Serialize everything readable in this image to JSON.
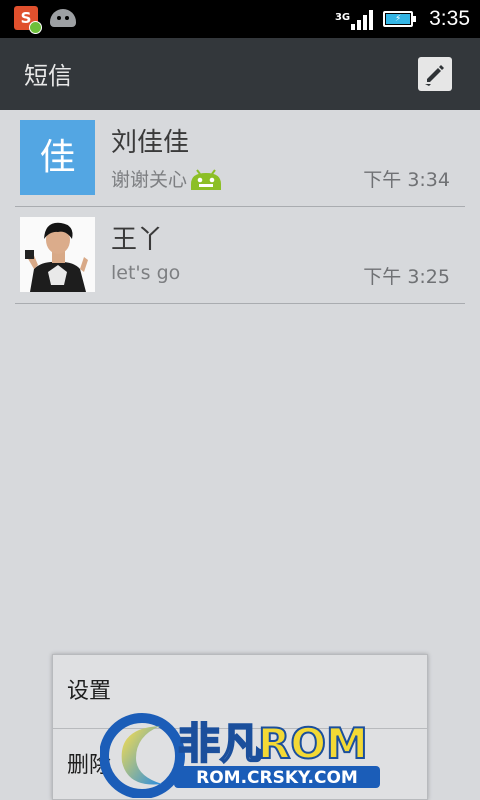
{
  "status_bar": {
    "network_type": "3G",
    "time": "3:35",
    "notification_icons": [
      "sogou-input-icon",
      "android-robot-icon"
    ],
    "battery_state": "charging"
  },
  "action_bar": {
    "title": "短信",
    "compose_icon": "compose-icon"
  },
  "conversations": [
    {
      "avatar_letter": "佳",
      "avatar_color": "#53a6e3",
      "name": "刘佳佳",
      "snippet": "谢谢关心",
      "snippet_emoji": "android-robot-emoji",
      "time": "下午 3:34"
    },
    {
      "avatar_photo": "contact-photo",
      "name": "王丫",
      "snippet": "let's go",
      "time": "下午 3:25"
    }
  ],
  "menu": {
    "items": [
      {
        "label": "设置"
      },
      {
        "label": "删除"
      }
    ]
  },
  "watermark": {
    "brand": "非凡ROM",
    "url": "ROM.CRSKY.COM"
  }
}
